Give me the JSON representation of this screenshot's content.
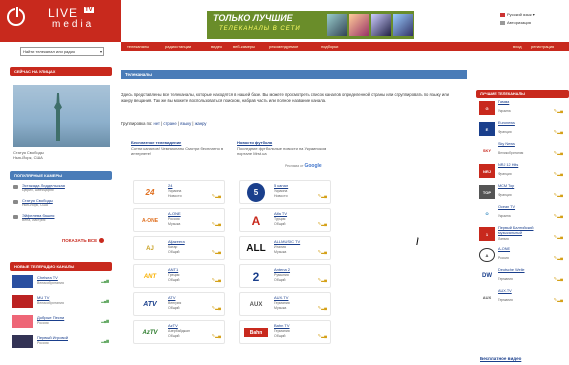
{
  "header": {
    "logo_live": "LIVE",
    "logo_tv": "TV",
    "logo_media": "media",
    "search_placeholder": "Найти телеканал или радио",
    "banner_title": "ТОЛЬКО ЛУЧШИЕ",
    "banner_sub": "ТЕЛЕКАНАЛЫ В СЕТИ",
    "lang_current": "Русский язык",
    "login": "Авторизация"
  },
  "top_nav": {
    "items": [
      "телеканалы",
      "радиостанции",
      "видео",
      "веб-камеры",
      "рекомендуемое",
      "подборки"
    ],
    "right": [
      "вход",
      "регистрация"
    ]
  },
  "left": {
    "street_head": "СЕЙЧАС НА УЛИЦАХ",
    "cam_caption_1": "Статуя Свободы",
    "cam_caption_2": "Нью-Йорк, США",
    "popular_head": "ПОПУЛЯРНЫЕ КАМЕРЫ",
    "popular": [
      {
        "name": "Эстакада Лиддельская",
        "sub": "Цюрих, Швейцария"
      },
      {
        "name": "Статуя Свободы",
        "sub": "Нью-Йорк, США"
      },
      {
        "name": "Эйфелева башня",
        "sub": "Вена, Австрия"
      }
    ],
    "show_all": "ПОКАЗАТЬ ВСЕ",
    "new_head": "НОВЫЕ ТЕЛЕРАДИО КАНАЛЫ",
    "new_items": [
      {
        "name": "Chelsea TV",
        "sub": "Великобритания"
      },
      {
        "name": "MU TV",
        "sub": "Великобритания"
      },
      {
        "name": "Добрые Песни",
        "sub": "Россия"
      },
      {
        "name": "Первый Игровой",
        "sub": "Россия"
      }
    ]
  },
  "main": {
    "head": "Телеканалы",
    "intro": "Здесь представлены все телеканалы, которые находятся в нашей базе. Вы можете просмотреть список каналов определенной страны или сгруппировать по языку или жанру вещания. Так же вы можете воспользоваться поиском, набрав часть или полное название канала.",
    "groupby_label": "Группировка по:",
    "groupby_links": [
      "нет",
      "стране",
      "языку",
      "жанру"
    ],
    "promo_left_title": "Бесплатное телевидение",
    "promo_left_desc": "Сотни каналов! Чемпионаты Смотри бесплатно в интернете!",
    "promo_left_link": "www",
    "promo_right_title": "Новости футбола",
    "promo_right_desc": "Последние футбольные новости на Украинском портале Mrst.ua",
    "google": "Google",
    "google_prefix": "Реклама от",
    "cards": [
      {
        "logo": "24",
        "name": "24",
        "country": "Украина",
        "genre": "Новости"
      },
      {
        "logo": "5",
        "name": "5 канал",
        "country": "Украина",
        "genre": "Новости"
      },
      {
        "logo": "A-ONE",
        "name": "A-ONE",
        "country": "Россия",
        "genre": "Музыка"
      },
      {
        "logo": "A",
        "name": "Alfa TV",
        "country": "Турция",
        "genre": "Общий"
      },
      {
        "logo": "AJ",
        "name": "Aljazeera",
        "country": "Катар",
        "genre": "Общий"
      },
      {
        "logo": "ALL",
        "name": "ALLMUSIC TV",
        "country": "Италия",
        "genre": "Музыка"
      },
      {
        "logo": "ANT",
        "name": "ANT1",
        "country": "Греция",
        "genre": "Общий"
      },
      {
        "logo": "2",
        "name": "Antena 2",
        "country": "Румыния",
        "genre": "Общий"
      },
      {
        "logo": "ATV",
        "name": "ATV",
        "country": "Венгрия",
        "genre": "Общий"
      },
      {
        "logo": "AUX",
        "name": "AUX.TV",
        "country": "Германия",
        "genre": "Музыка"
      },
      {
        "logo": "AzTV",
        "name": "AzTV",
        "country": "Азербайджан",
        "genre": "Общий"
      },
      {
        "logo": "Bahn",
        "name": "Bahn TV",
        "country": "Германия",
        "genre": "Общий"
      }
    ]
  },
  "right": {
    "head": "ЛУЧШИЕ ТЕЛЕКАНАЛЫ",
    "items": [
      {
        "logo": "G",
        "name": "Гамма",
        "country": "Украина"
      },
      {
        "logo": "Е",
        "name": "Euronews",
        "country": "Франция"
      },
      {
        "logo": "SKY",
        "name": "Sky News",
        "country": "Великобритания"
      },
      {
        "logo": "NRJ",
        "name": "NRJ 12 Hits",
        "country": "Франция"
      },
      {
        "logo": "TOP",
        "name": "MCM Top",
        "country": "Франция"
      },
      {
        "logo": "O",
        "name": "Ocean TV",
        "country": "Украина"
      },
      {
        "logo": "1",
        "name": "Первый Балтийский музыкальный",
        "country": "Латвия"
      },
      {
        "logo": "A",
        "name": "A-ONE",
        "country": "Россия"
      },
      {
        "logo": "DW",
        "name": "Deutsche Welle",
        "country": "Германия"
      },
      {
        "logo": "AUX",
        "name": "AUX.TV",
        "country": "Германия"
      }
    ],
    "free_video": "Бесплатное видео"
  },
  "colors": {
    "brand_red": "#c8291d",
    "nav_blue": "#4a7cb8",
    "link": "#1a3f8c"
  }
}
